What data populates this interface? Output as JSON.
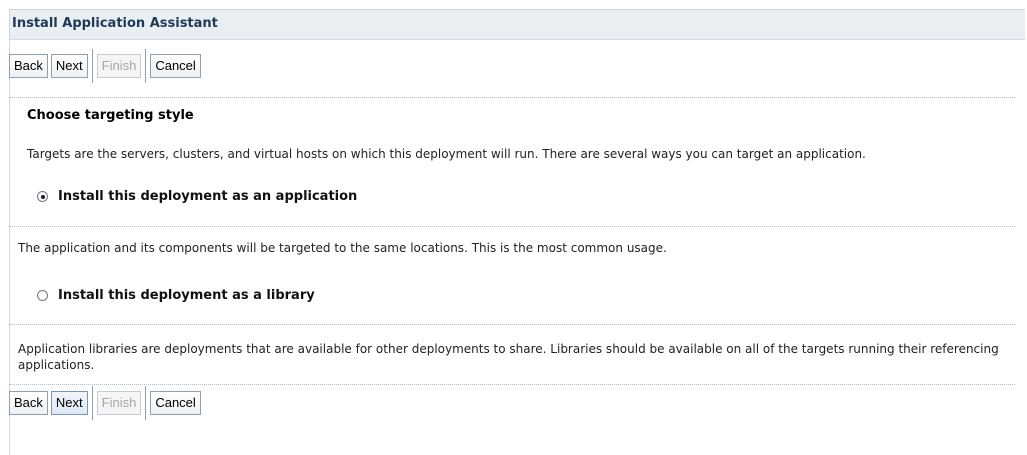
{
  "title": "Install Application Assistant",
  "buttons": {
    "back": "Back",
    "next": "Next",
    "finish": "Finish",
    "cancel": "Cancel"
  },
  "section": {
    "heading": "Choose targeting style",
    "description": "Targets are the servers, clusters, and virtual hosts on which this deployment will run. There are several ways you can target an application."
  },
  "options": [
    {
      "label": "Install this deployment as an application",
      "checked": true,
      "description": "The application and its components will be targeted to the same locations. This is the most common usage."
    },
    {
      "label": "Install this deployment as a library",
      "checked": false,
      "description": "Application libraries are deployments that are available for other deployments to share. Libraries should be available on all of the targets running their referencing applications."
    }
  ],
  "colors": {
    "title_text": "#1f3a57",
    "title_bg": "#e9eef2",
    "disabled_text": "#a6a6a6"
  }
}
